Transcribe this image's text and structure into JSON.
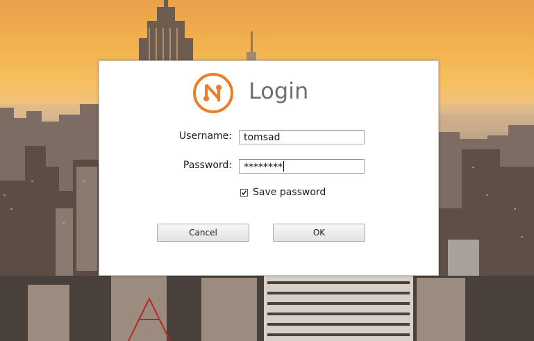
{
  "dialog": {
    "title": "Login",
    "logo_icon": "n-network-logo-icon",
    "accent_color": "#f07c27",
    "username_label": "Username:",
    "username_value": "tomsad",
    "password_label": "Password:",
    "password_value": "********",
    "save_password_label": "Save password",
    "save_password_checked": true,
    "cancel_label": "Cancel",
    "ok_label": "OK"
  },
  "background": {
    "description_icon": "city-skyline-wallpaper"
  }
}
